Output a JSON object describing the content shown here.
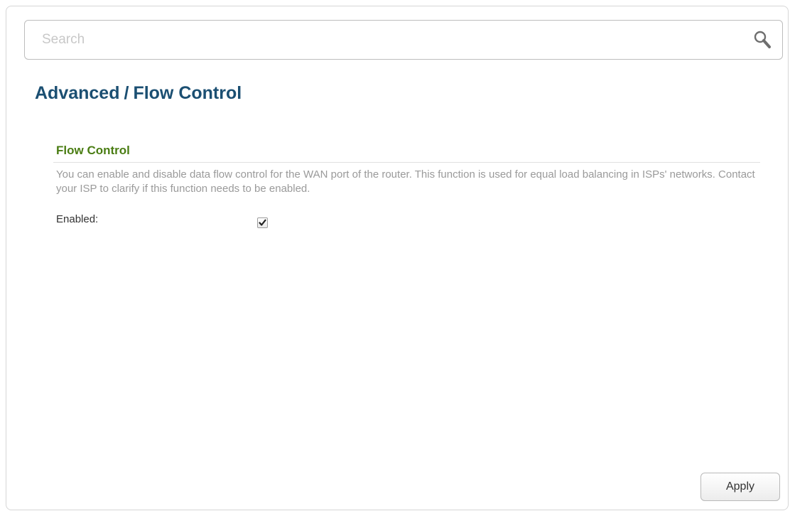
{
  "search": {
    "placeholder": "Search",
    "value": "",
    "icon": "search-icon"
  },
  "breadcrumb": {
    "parent": "Advanced",
    "separator": "/",
    "current": "Flow Control"
  },
  "section": {
    "title": "Flow Control",
    "description": "You can enable and disable data flow control for the WAN port of the router. This function is used for equal load balancing in ISPs' networks. Contact your ISP to clarify if this function needs to be enabled."
  },
  "fields": {
    "enabled": {
      "label": "Enabled:",
      "checked": true
    }
  },
  "actions": {
    "apply_label": "Apply"
  },
  "colors": {
    "title": "#1b4f72",
    "section_title": "#4a7d13",
    "description": "#9a9a9a"
  }
}
